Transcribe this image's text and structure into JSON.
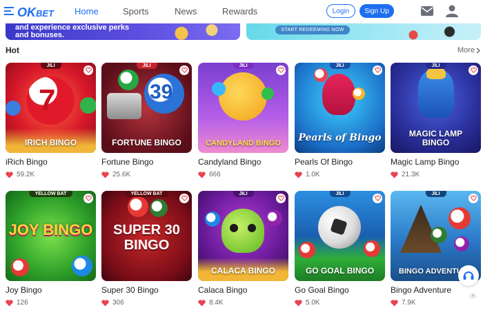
{
  "header": {
    "logo_text": "OKBET",
    "nav": [
      {
        "label": "Home"
      },
      {
        "label": "Sports"
      },
      {
        "label": "News"
      },
      {
        "label": "Rewards"
      }
    ],
    "login_label": "Login",
    "signup_label": "Sign Up",
    "accent_color": "#1e6ff0"
  },
  "banners": {
    "left_text": "and experience exclusive perks and bonuses.",
    "right_button": "START REDEEMING NOW"
  },
  "section": {
    "title": "Hot",
    "more_label": "More"
  },
  "games": [
    {
      "provider": "JILI",
      "thumb_title": "IRICH BINGO",
      "name": "iRich Bingo",
      "likes": "59.2K"
    },
    {
      "provider": "JILI",
      "thumb_title": "FORTUNE BINGO",
      "name": "Fortune Bingo",
      "likes": "25.6K"
    },
    {
      "provider": "JILI",
      "thumb_title": "CANDYLAND BINGO",
      "name": "Candyland Bingo",
      "likes": "666"
    },
    {
      "provider": "JILI",
      "thumb_title": "Pearls of Bingo",
      "name": "Pearls Of Bingo",
      "likes": "1.0K"
    },
    {
      "provider": "JILI",
      "thumb_title": "MAGIC LAMP BINGO",
      "name": "Magic Lamp Bingo",
      "likes": "21.3K"
    },
    {
      "provider": "YELLOW BAT",
      "thumb_title": "JOY BINGO",
      "name": "Joy Bingo",
      "likes": "126"
    },
    {
      "provider": "YELLOW BAT",
      "thumb_title": "SUPER 30 BINGO",
      "name": "Super 30 Bingo",
      "likes": "306"
    },
    {
      "provider": "JILI",
      "thumb_title": "CALACA BINGO",
      "name": "Calaca Bingo",
      "likes": "8.4K"
    },
    {
      "provider": "JILI",
      "thumb_title": "GO GOAL BINGO",
      "name": "Go Goal Bingo",
      "likes": "5.0K"
    },
    {
      "provider": "JILI",
      "thumb_title": "BINGO ADVENTURE",
      "name": "Bingo Adventure",
      "likes": "7.9K"
    }
  ],
  "icons": {
    "menu": "menu-icon",
    "mail": "mail-icon",
    "user": "user-icon",
    "heart": "heart-icon",
    "favorite": "favorite-icon",
    "support": "headset-icon",
    "close": "close-icon"
  }
}
